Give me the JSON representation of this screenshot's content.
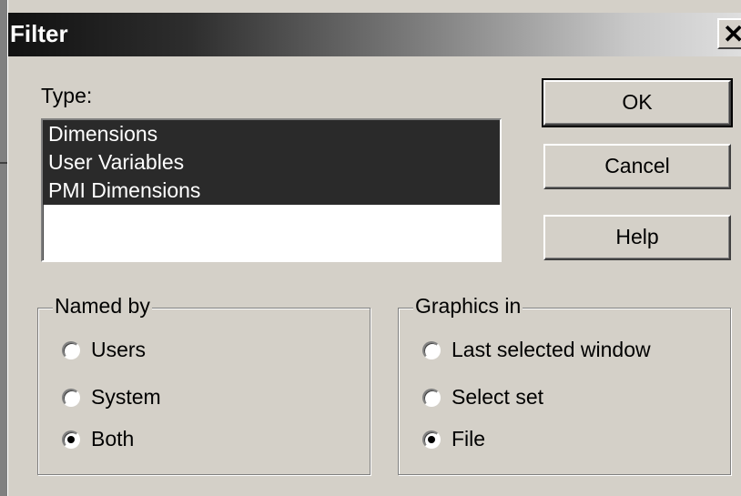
{
  "window": {
    "title": "Filter",
    "close_glyph": "✕"
  },
  "type_section": {
    "label": "Type:",
    "items": [
      "Dimensions",
      "User Variables",
      "PMI Dimensions"
    ]
  },
  "buttons": {
    "ok": "OK",
    "cancel": "Cancel",
    "help": "Help"
  },
  "named_by": {
    "title": "Named by",
    "options": [
      "Users",
      "System",
      "Both"
    ],
    "selected": "Both"
  },
  "graphics_in": {
    "title": "Graphics in",
    "options": [
      "Last selected window",
      "Select set",
      "File"
    ],
    "selected": "File"
  },
  "colors": {
    "dialog_bg": "#d4d0c8",
    "selection_bg": "#2a2a2a",
    "title_gradient_start": "#111111",
    "title_gradient_end": "#dedede"
  },
  "icons": {
    "close": "close-icon",
    "radio": "radio-button-icon"
  }
}
